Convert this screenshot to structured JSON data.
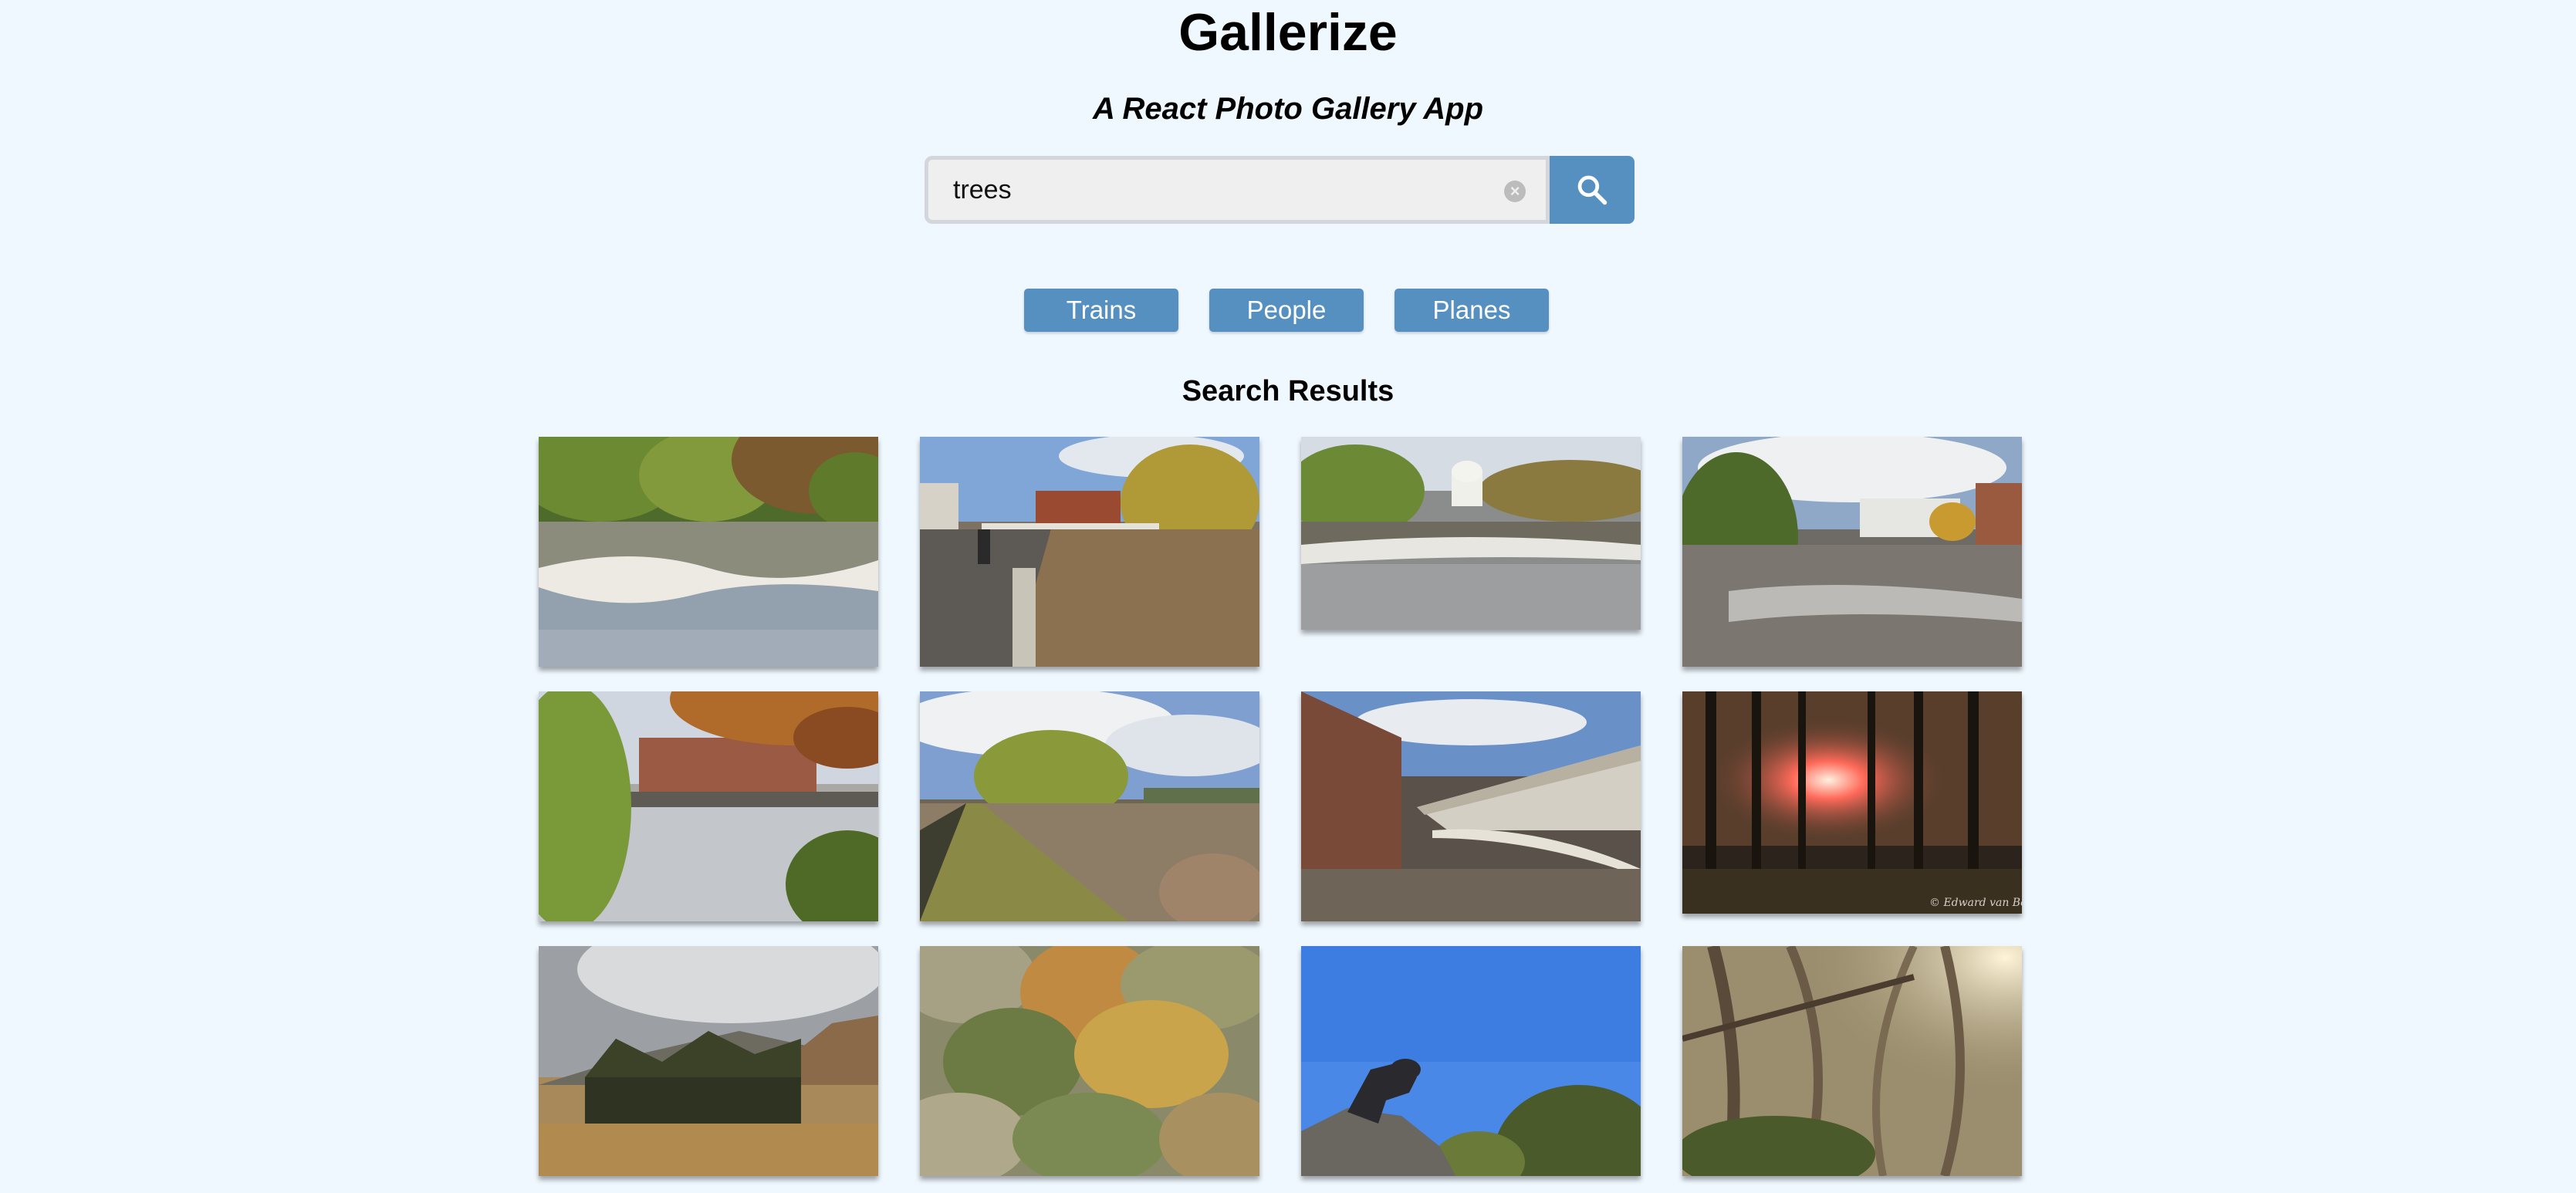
{
  "header": {
    "title": "Gallerize",
    "subtitle": "A React Photo Gallery App"
  },
  "search": {
    "value": "trees",
    "clear_icon": "clear-icon",
    "button_icon": "search-icon"
  },
  "nav": {
    "buttons": [
      "Trains",
      "People",
      "Planes"
    ]
  },
  "results": {
    "title": "Search Results",
    "photos": [
      {
        "subject": "river-rapids-with-trees"
      },
      {
        "subject": "riverside-walkway-cyclist-bridge"
      },
      {
        "subject": "weir-with-willows-and-building"
      },
      {
        "subject": "flooded-river-with-buildings"
      },
      {
        "subject": "river-framed-by-autumn-branches"
      },
      {
        "subject": "flooded-river-embankment"
      },
      {
        "subject": "bridge-over-river"
      },
      {
        "subject": "sunset-through-trees-with-signature"
      },
      {
        "subject": "forest-before-mountain"
      },
      {
        "subject": "autumn-forest"
      },
      {
        "subject": "dog-statue-blue-sky"
      },
      {
        "subject": "tangled-tree-trunks-sunlight"
      }
    ]
  },
  "colors": {
    "background": "#f0f8ff",
    "accent": "#5590c1"
  }
}
